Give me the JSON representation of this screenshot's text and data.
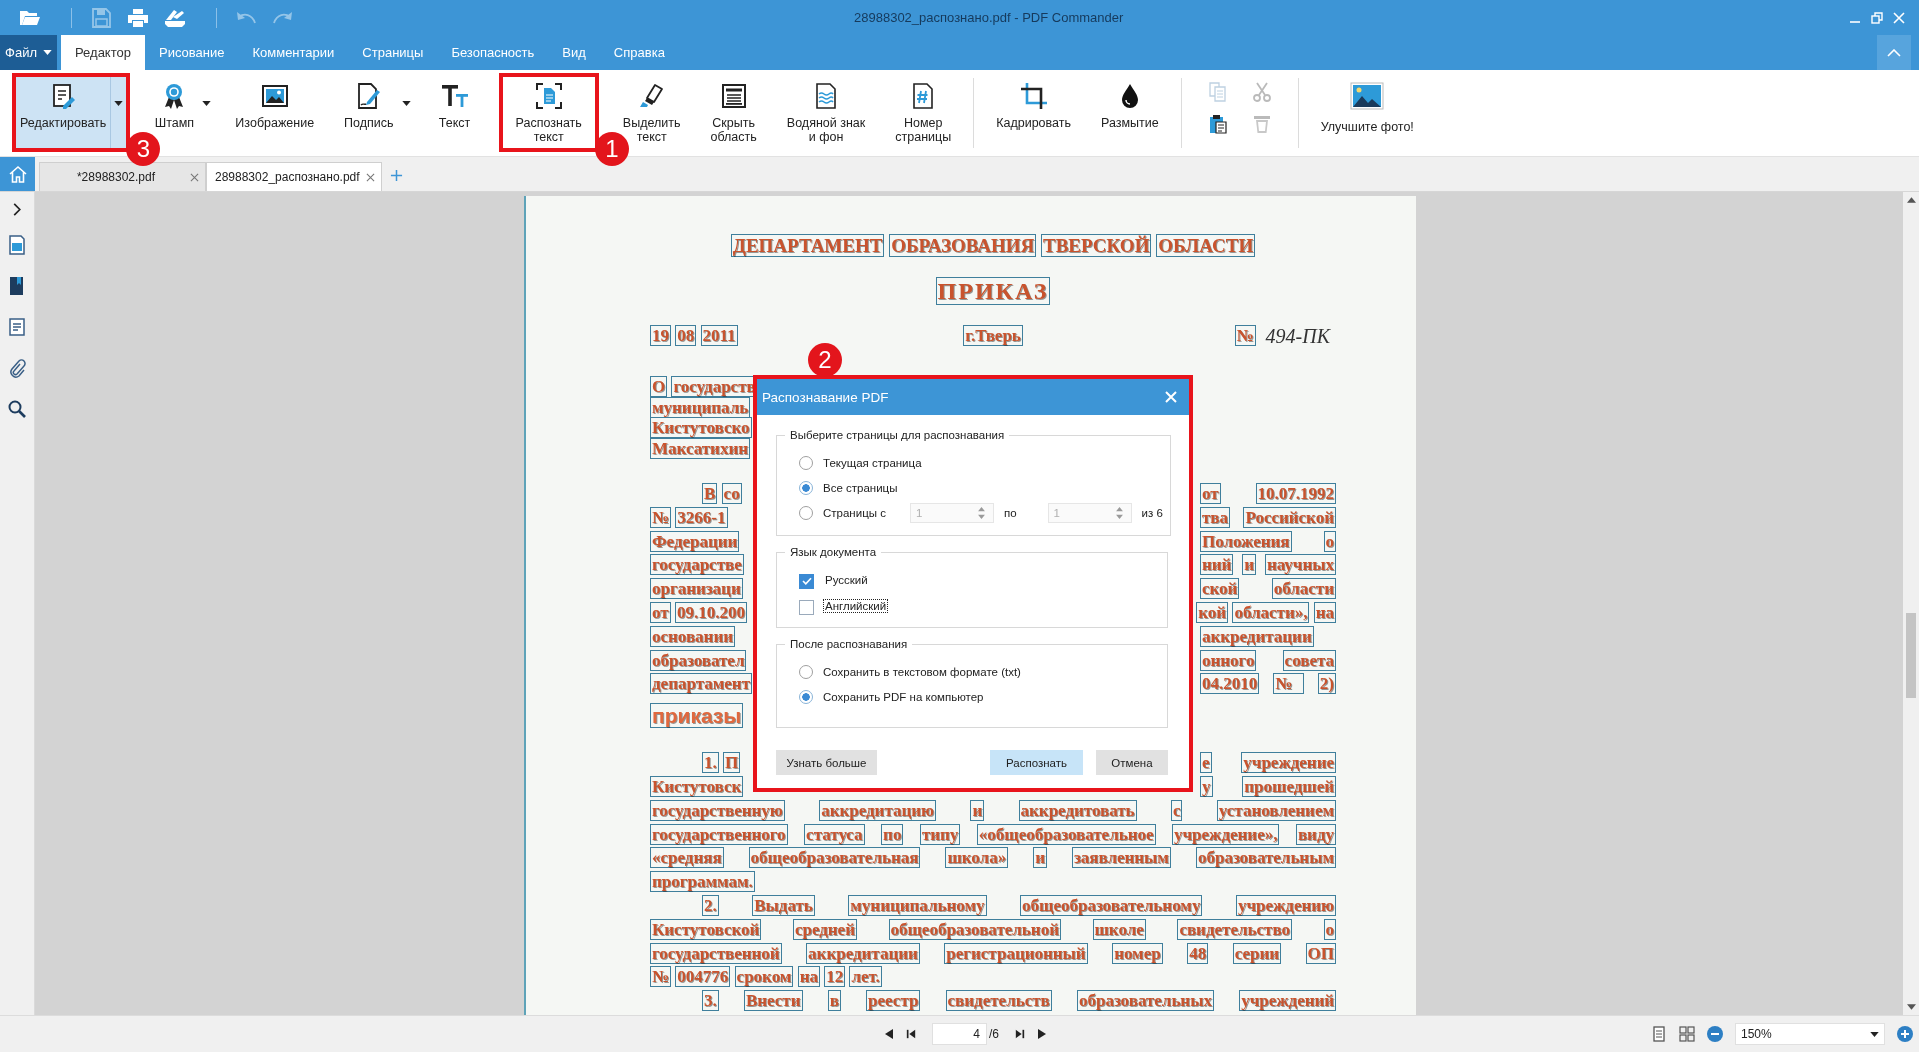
{
  "window": {
    "title": "28988302_распознано.pdf - PDF Commander"
  },
  "quick_access": [
    [
      {
        "kind": "open",
        "disabled": false
      }
    ],
    [
      {
        "kind": "save",
        "disabled": true
      },
      {
        "kind": "print",
        "disabled": false
      },
      {
        "kind": "scan",
        "disabled": false
      }
    ],
    [
      {
        "kind": "undo",
        "disabled": true
      },
      {
        "kind": "redo",
        "disabled": true
      }
    ]
  ],
  "menu": {
    "file": "Файл",
    "tabs": [
      {
        "label": "Редактор",
        "selected": true
      },
      {
        "label": "Рисование",
        "selected": false
      },
      {
        "label": "Комментарии",
        "selected": false
      },
      {
        "label": "Страницы",
        "selected": false
      },
      {
        "label": "Безопасность",
        "selected": false
      },
      {
        "label": "Вид",
        "selected": false
      },
      {
        "label": "Справка",
        "selected": false
      }
    ]
  },
  "ribbon": {
    "groups": [
      {
        "kind": "tools",
        "items": [
          {
            "kind": "edit",
            "label_lines": [
              "Редактировать"
            ],
            "dropdown": true,
            "selected": true,
            "highlighted": true,
            "badge": "3"
          },
          {
            "kind": "stamp",
            "label_lines": [
              "Штамп"
            ],
            "dropdown": true,
            "selected": false,
            "highlighted": false
          },
          {
            "kind": "image",
            "label_lines": [
              "Изображение"
            ],
            "dropdown": false,
            "selected": false,
            "highlighted": false
          },
          {
            "kind": "signature",
            "label_lines": [
              "Подпись"
            ],
            "dropdown": true,
            "selected": false,
            "highlighted": false
          },
          {
            "kind": "text",
            "label_lines": [
              "Текст"
            ],
            "dropdown": false,
            "selected": false,
            "highlighted": false
          },
          {
            "kind": "recognize",
            "label_lines": [
              "Распознать",
              "текст"
            ],
            "dropdown": false,
            "selected": false,
            "highlighted": true,
            "badge": "1"
          },
          {
            "kind": "highlight",
            "label_lines": [
              "Выделить",
              "текст"
            ],
            "dropdown": false,
            "selected": false,
            "highlighted": false
          },
          {
            "kind": "hide",
            "label_lines": [
              "Скрыть",
              "область"
            ],
            "dropdown": false,
            "selected": false,
            "highlighted": false
          },
          {
            "kind": "watermark",
            "label_lines": [
              "Водяной знак",
              "и фон"
            ],
            "dropdown": false,
            "selected": false,
            "highlighted": false
          },
          {
            "kind": "pagenumber",
            "label_lines": [
              "Номер",
              "страницы"
            ],
            "dropdown": false,
            "selected": false,
            "highlighted": false
          }
        ]
      },
      {
        "kind": "tools",
        "items": [
          {
            "kind": "crop",
            "label_lines": [
              "Кадрировать"
            ],
            "dropdown": false,
            "selected": false,
            "highlighted": false
          },
          {
            "kind": "blur",
            "label_lines": [
              "Размытие"
            ],
            "dropdown": false,
            "selected": false,
            "highlighted": false
          }
        ]
      },
      {
        "kind": "clipboard",
        "items": [
          {
            "kind": "copy",
            "disabled": true
          },
          {
            "kind": "cut",
            "disabled": true
          },
          {
            "kind": "paste",
            "disabled": false
          },
          {
            "kind": "delete",
            "disabled": true
          }
        ]
      },
      {
        "kind": "tools",
        "items": [
          {
            "kind": "enhance",
            "label_lines": [
              "Улучшите фото!"
            ],
            "dropdown": false,
            "selected": false,
            "highlighted": false
          }
        ]
      }
    ]
  },
  "doc_tabs": [
    {
      "label": "*28988302.pdf",
      "selected": false
    },
    {
      "label": "28988302_распознано.pdf",
      "selected": true
    }
  ],
  "document": {
    "heading": "ДЕПАРТАМЕНТ ОБРАЗОВАНИЯ ТВЕРСКОЙ ОБЛАСТИ",
    "title": "ПРИКАЗ",
    "date": "19 08 2011",
    "city": "г.Тверь",
    "number_sign": "№",
    "number": "494-ПК",
    "subject_lines": [
      "О государств",
      "муниципаль",
      "Кистутовско",
      "Максатихин"
    ],
    "lines": [
      {
        "kind": "split",
        "indent": true,
        "left": "В со",
        "right": "от 10.07.1992"
      },
      {
        "kind": "split",
        "indent": false,
        "left": "№ 3266-1",
        "right": "тва Российской"
      },
      {
        "kind": "split",
        "indent": false,
        "left": "Федерации",
        "right": "Положения о"
      },
      {
        "kind": "split",
        "indent": false,
        "left": "государстве",
        "right": "ний и научных"
      },
      {
        "kind": "split",
        "indent": false,
        "left": "организаци",
        "right": "ской области"
      },
      {
        "kind": "split",
        "indent": false,
        "left": "от 09.10.200",
        "right": "кой области», на"
      },
      {
        "kind": "split",
        "indent": false,
        "left": "основании",
        "right": "аккредитации"
      },
      {
        "kind": "split",
        "indent": false,
        "left": "образовател",
        "right": "онного совета"
      },
      {
        "kind": "split",
        "indent": false,
        "left": "департамент",
        "right": "04.2010 № 2)"
      },
      {
        "kind": "caption",
        "indent": false,
        "left": "приказы"
      },
      {
        "kind": "split",
        "indent": true,
        "left": "1. П",
        "right": "е учреждение"
      },
      {
        "kind": "split",
        "indent": false,
        "left": "Кистутовск",
        "right": "у прошедшей"
      },
      {
        "kind": "justify",
        "indent": false,
        "text": "государственную аккредитацию и аккредитовать с установлением"
      },
      {
        "kind": "justify",
        "indent": false,
        "text": "государственного статуса по типу «общеобразовательное учреждение», виду"
      },
      {
        "kind": "justify",
        "indent": false,
        "text": "«средняя общеобразовательная школа» и заявленным образовательным"
      },
      {
        "kind": "left",
        "indent": false,
        "text": "программам."
      },
      {
        "kind": "justify",
        "indent": true,
        "text": "2. Выдать муниципальному общеобразовательному учреждению"
      },
      {
        "kind": "justify",
        "indent": false,
        "text": "Кистутовской средней общеобразовательной школе свидетельство о"
      },
      {
        "kind": "justify",
        "indent": false,
        "text": "государственной аккредитации регистрационный номер 48 серии ОП"
      },
      {
        "kind": "left",
        "indent": false,
        "text": "№ 004776 сроком на 12 лет."
      },
      {
        "kind": "justify",
        "indent": true,
        "text": "3. Внести в реестр свидетельств образовательных учреждений"
      }
    ]
  },
  "dialog": {
    "title": "Распознавание PDF",
    "highlighted": true,
    "badge": "2",
    "pages": {
      "legend": "Выберите страницы для распознавания",
      "options": [
        {
          "label": "Текущая страница",
          "selected": false
        },
        {
          "label": "Все страницы",
          "selected": true
        },
        {
          "label": "Страницы с",
          "selected": false,
          "range": {
            "from": "1",
            "between": "по",
            "to": "1",
            "total": "из 6",
            "disabled": true
          }
        }
      ]
    },
    "language": {
      "legend": "Язык документа",
      "options": [
        {
          "label": "Русский",
          "checked": true,
          "focused": false
        },
        {
          "label": "Английский",
          "checked": false,
          "focused": true
        }
      ]
    },
    "after": {
      "legend": "После распознавания",
      "options": [
        {
          "label": "Сохранить в текстовом формате (txt)",
          "selected": false
        },
        {
          "label": "Сохранить PDF на компьютер",
          "selected": true
        }
      ]
    },
    "buttons": [
      {
        "label": "Узнать больше",
        "kind": "secondary"
      },
      {
        "label": "Распознать",
        "kind": "primary"
      },
      {
        "label": "Отмена",
        "kind": "secondary"
      }
    ]
  },
  "status_bar": {
    "page": "4",
    "page_count": "/6",
    "zoom": "150%"
  }
}
